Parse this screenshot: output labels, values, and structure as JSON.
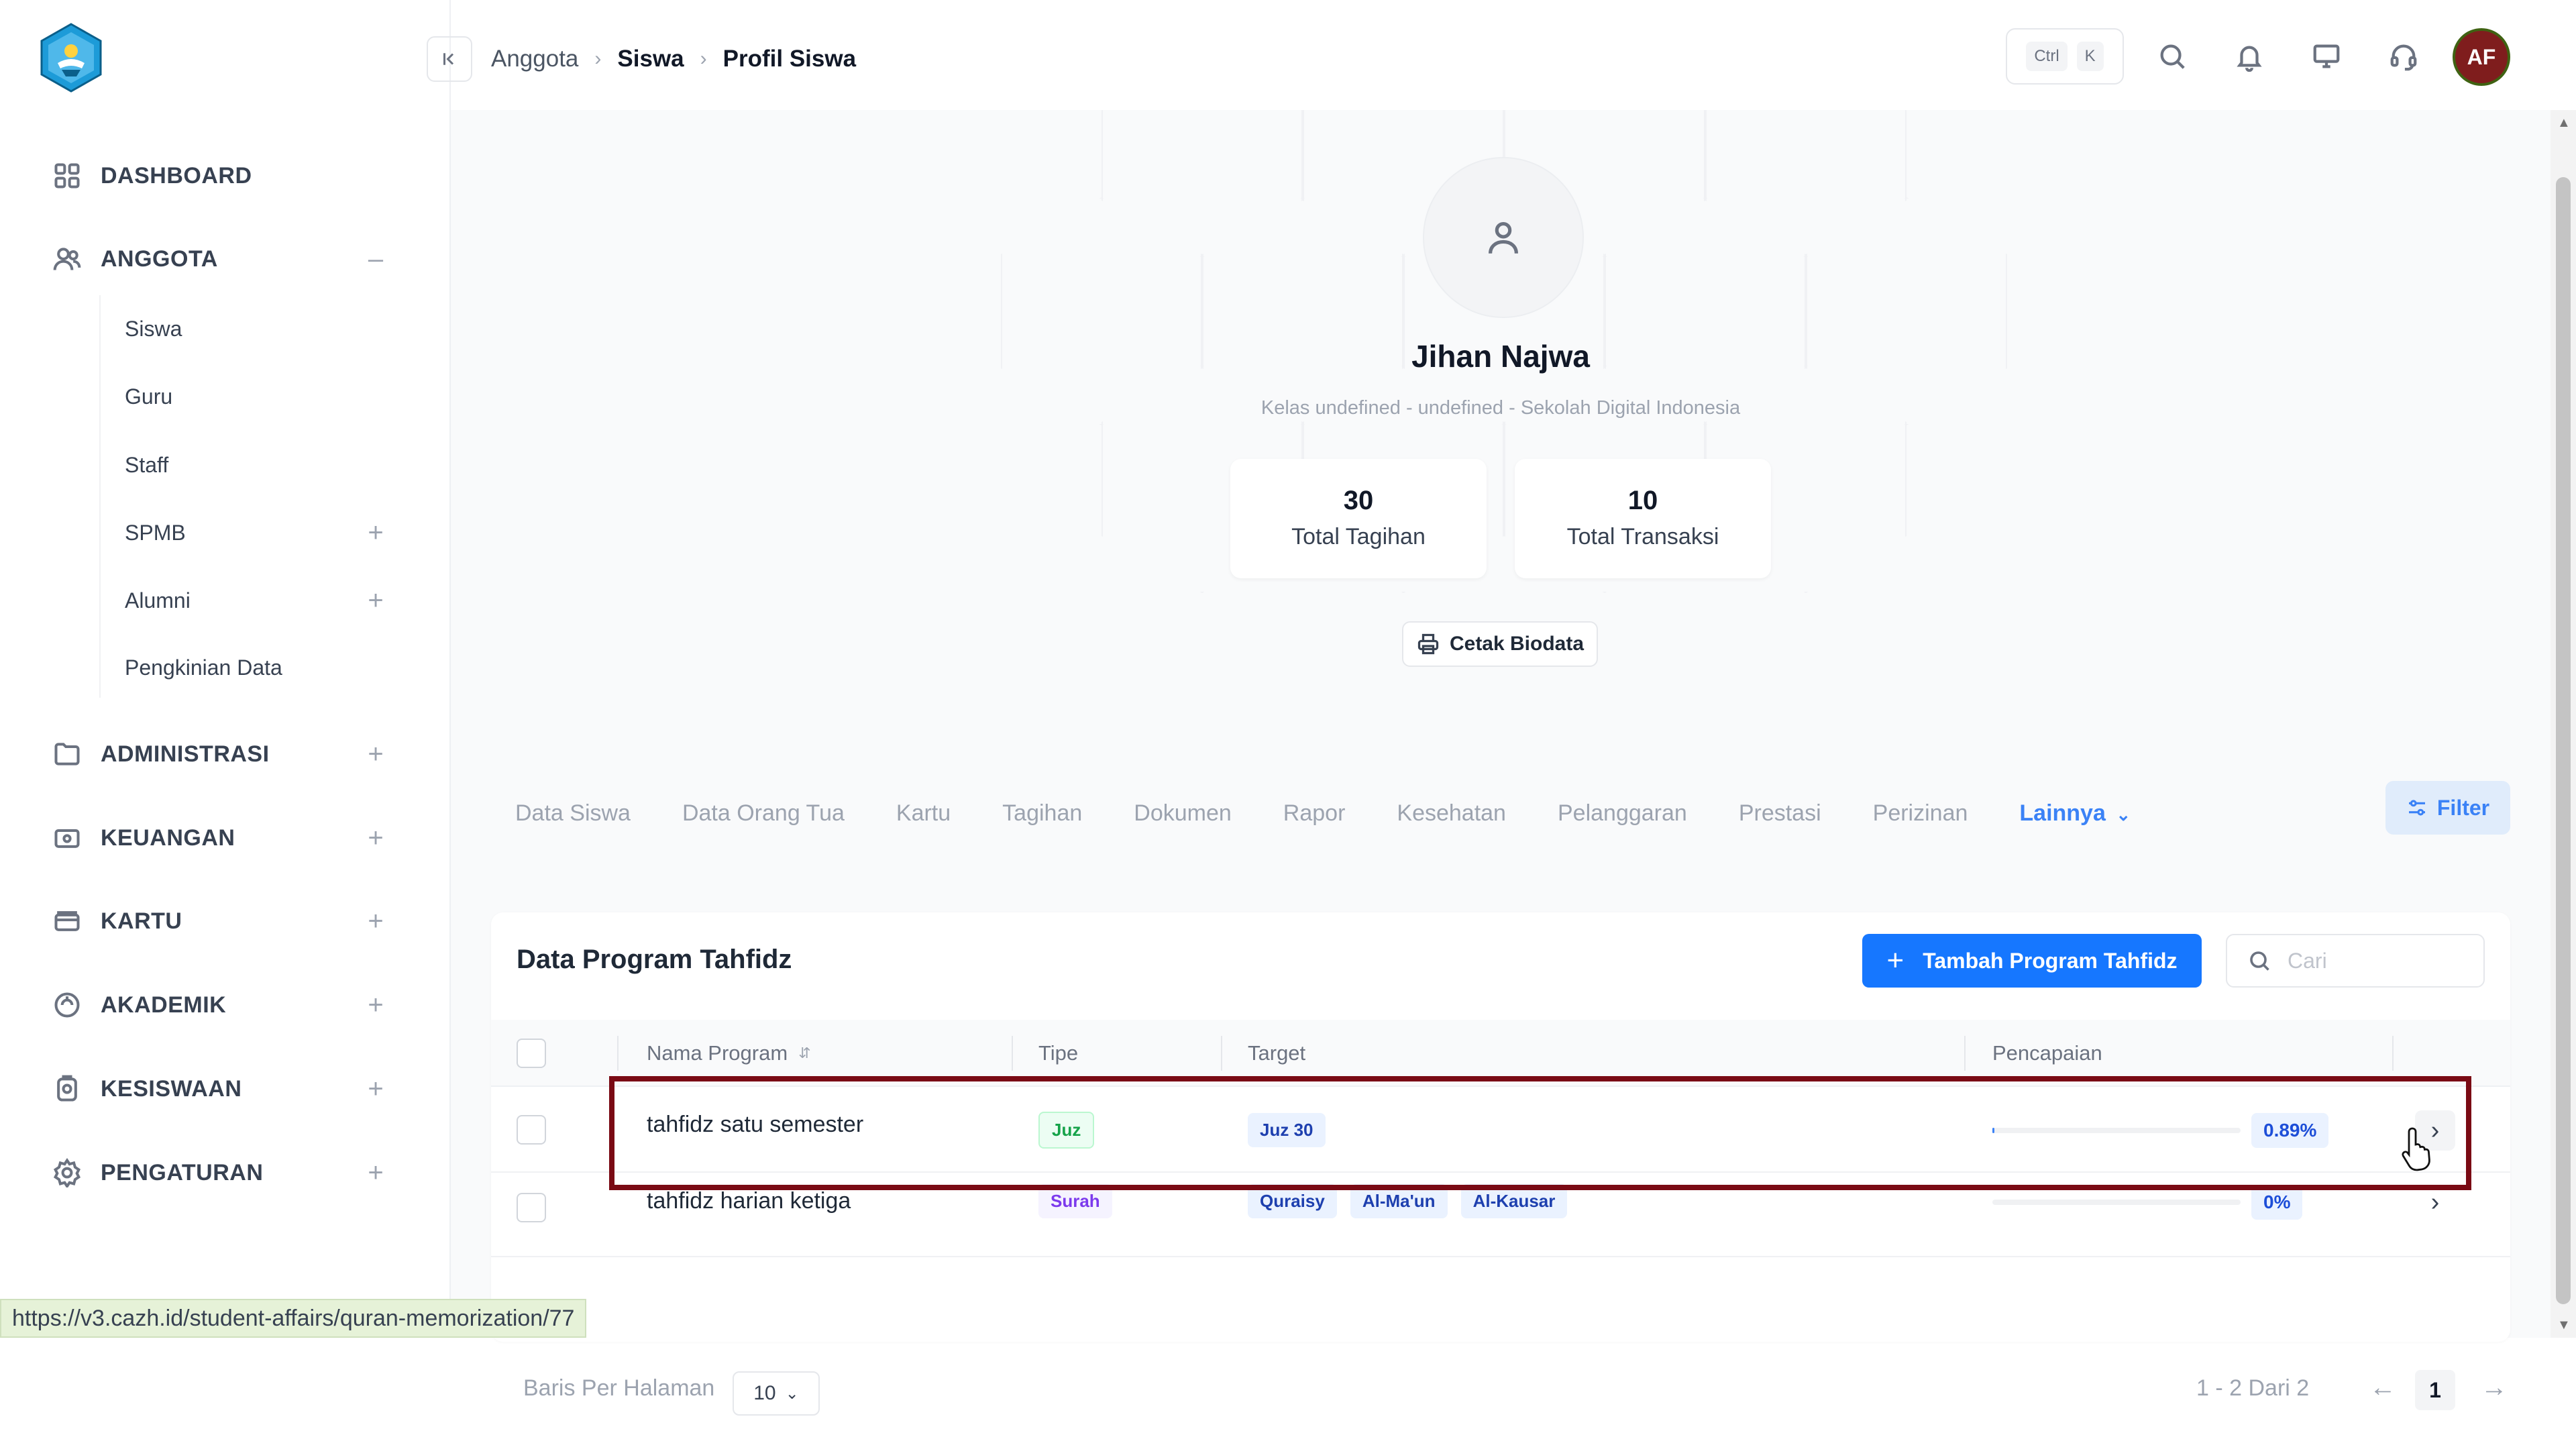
{
  "sidebar": {
    "items": [
      {
        "label": "DASHBOARD",
        "icon": "grid-icon"
      },
      {
        "label": "ANGGOTA",
        "icon": "users-icon",
        "toggle": "–"
      },
      {
        "label": "ADMINISTRASI",
        "icon": "folder-icon",
        "toggle": "+"
      },
      {
        "label": "KEUANGAN",
        "icon": "wallet-icon",
        "toggle": "+"
      },
      {
        "label": "KARTU",
        "icon": "card-icon",
        "toggle": "+"
      },
      {
        "label": "AKADEMIK",
        "icon": "academic-icon",
        "toggle": "+"
      },
      {
        "label": "KESISWAAN",
        "icon": "student-icon",
        "toggle": "+"
      },
      {
        "label": "PENGATURAN",
        "icon": "gear-icon",
        "toggle": "+"
      }
    ],
    "anggota_sub": [
      {
        "label": "Siswa"
      },
      {
        "label": "Guru"
      },
      {
        "label": "Staff"
      },
      {
        "label": "SPMB",
        "toggle": "+"
      },
      {
        "label": "Alumni",
        "toggle": "+"
      },
      {
        "label": "Pengkinian Data"
      }
    ]
  },
  "breadcrumb": [
    "Anggota",
    "Siswa",
    "Profil Siswa"
  ],
  "shortcut": [
    "Ctrl",
    "K"
  ],
  "user": {
    "initials": "AF"
  },
  "profile": {
    "name": "Jihan Najwa",
    "subtitle": "Kelas undefined - undefined - Sekolah Digital Indonesia",
    "stats": [
      {
        "value": "30",
        "label": "Total Tagihan"
      },
      {
        "value": "10",
        "label": "Total Transaksi"
      }
    ],
    "print_label": "Cetak Biodata"
  },
  "tabs": [
    "Data Siswa",
    "Data Orang Tua",
    "Kartu",
    "Tagihan",
    "Dokumen",
    "Rapor",
    "Kesehatan",
    "Pelanggaran",
    "Prestasi",
    "Perizinan",
    "Lainnya"
  ],
  "filter_label": "Filter",
  "table": {
    "title": "Data Program Tahfidz",
    "add_label": "Tambah Program Tahfidz",
    "search_placeholder": "Cari",
    "headers": [
      "Nama Program",
      "Tipe",
      "Target",
      "Pencapaian"
    ],
    "rows": [
      {
        "name": "tahfidz satu semester",
        "type": "Juz",
        "targets": [
          "Juz 30"
        ],
        "progress_percent": 0.89,
        "percent_label": "0.89%"
      },
      {
        "name": "tahfidz harian ketiga",
        "type": "Surah",
        "targets": [
          "Quraisy",
          "Al-Ma'un",
          "Al-Kausar"
        ],
        "progress_percent": 0,
        "percent_label": "0%"
      }
    ]
  },
  "pagination": {
    "rows_label": "Baris Per Halaman",
    "rows_value": "10",
    "info": "1 - 2 Dari 2",
    "current_page": "1"
  },
  "status_url": "https://v3.cazh.id/student-affairs/quran-memorization/77",
  "colors": {
    "primary": "#1677ff",
    "highlight": "#7a0a14",
    "avatar_bg": "#7f1d1d"
  }
}
